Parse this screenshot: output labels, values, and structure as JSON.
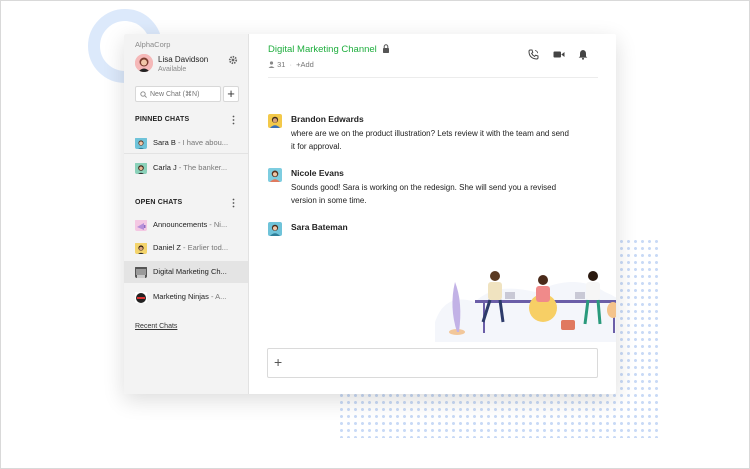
{
  "sidebar": {
    "org": "AlphaCorp",
    "user": {
      "name": "Lisa Davidson",
      "status": "Available"
    },
    "search_placeholder": "New Chat (⌘N)",
    "pinned_title": "PINNED CHATS",
    "pinned": [
      {
        "name": "Sara B",
        "preview": " - I have abou..."
      },
      {
        "name": "Carla J",
        "preview": " - The banker..."
      }
    ],
    "open_title": "OPEN CHATS",
    "open": [
      {
        "name": "Announcements",
        "preview": " - Ni..."
      },
      {
        "name": "Daniel Z",
        "preview": " - Earlier tod..."
      },
      {
        "name": "Digital Marketing Ch...",
        "preview": ""
      },
      {
        "name": "Marketing Ninjas",
        "preview": " - A..."
      }
    ],
    "recent_link": "Recent Chats"
  },
  "header": {
    "channel": "Digital Marketing Channel",
    "member_count": "31",
    "add_label": "+Add",
    "icons": [
      "phone-icon",
      "video-icon",
      "bell-icon"
    ]
  },
  "messages": [
    {
      "sender": "Brandon Edwards",
      "text": "where are we on the product illustration? Lets review it with the team and send it for approval."
    },
    {
      "sender": "Nicole Evans",
      "text": "Sounds good! Sara is working on the redesign. She will send you a revised version in some time."
    },
    {
      "sender": "Sara Bateman",
      "text": ""
    }
  ],
  "composer": {
    "placeholder": ""
  },
  "colors": {
    "accent": "#1fae3e",
    "deco": "#c9daf6"
  }
}
